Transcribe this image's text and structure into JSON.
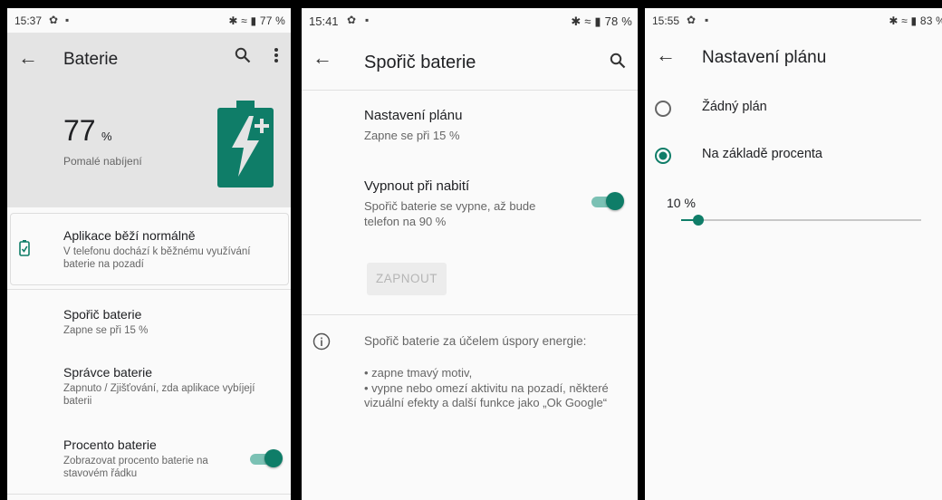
{
  "panel1": {
    "status": {
      "time": "15:37",
      "battery": "77 %"
    },
    "title": "Baterie",
    "percent": "77",
    "percent_unit": "%",
    "charging_text": "Pomalé nabíjení",
    "card": {
      "title": "Aplikace běží normálně",
      "desc": "V telefonu dochází k běžnému využívání baterie na pozadí"
    },
    "items": [
      {
        "title": "Spořič baterie",
        "desc": "Zapne se při 15 %"
      },
      {
        "title": "Správce baterie",
        "desc": "Zapnuto / Zjišťování, zda aplikace vybíjejí baterii"
      },
      {
        "title": "Procento baterie",
        "desc": "Zobrazovat procento baterie na stavovém řádku",
        "toggle_on": true
      }
    ],
    "accent": "#0f7d68"
  },
  "panel2": {
    "status": {
      "time": "15:41",
      "battery": "78 %"
    },
    "title": "Spořič baterie",
    "schedule": {
      "title": "Nastavení plánu",
      "desc": "Zapne se při 15 %"
    },
    "charge_off": {
      "title": "Vypnout při nabití",
      "desc": "Spořič baterie se vypne, až bude telefon na 90 %",
      "toggle_on": true
    },
    "button": "ZAPNOUT",
    "info": {
      "title": "Spořič baterie za účelem úspory energie:",
      "bullets": [
        "• zapne tmavý motiv,",
        "• vypne nebo omezí aktivitu na pozadí, některé vizuální efekty a další funkce jako „Ok Google“"
      ]
    }
  },
  "panel3": {
    "status": {
      "time": "15:55",
      "battery": "83 %"
    },
    "title": "Nastavení plánu",
    "options": [
      {
        "label": "Žádný plán",
        "selected": false
      },
      {
        "label": "Na základě procenta",
        "selected": true
      }
    ],
    "slider_label": "10 %",
    "slider_fraction": 0.035
  }
}
